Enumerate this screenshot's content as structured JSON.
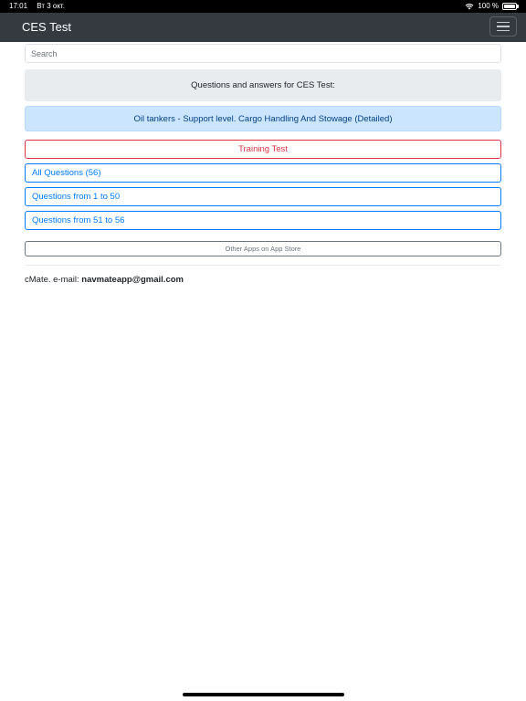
{
  "status_bar": {
    "time": "17:01",
    "date": "Вт 3 окт.",
    "battery": "100 %"
  },
  "navbar": {
    "title": "CES Test",
    "menu_icon": "hamburger-menu-icon"
  },
  "search": {
    "placeholder": "Search",
    "value": ""
  },
  "jumbotron": {
    "text": "Questions and answers for CES Test:"
  },
  "topic": {
    "text": "Oil tankers - Support level. Cargo Handling And Stowage (Detailed)"
  },
  "buttons": {
    "training_test": "Training Test",
    "all_questions": "All Questions (56)",
    "range_1": "Questions from 1 to 50",
    "range_2": "Questions from 51 to 56",
    "other_apps": "Other Apps on App Store"
  },
  "footer": {
    "prefix": "cMate. e-mail: ",
    "email": "navmateapp@gmail.com"
  },
  "colors": {
    "navbar_bg": "#343a40",
    "primary": "#007bff",
    "danger": "#dc3545",
    "secondary": "#6c757d",
    "info_bg": "#cce5ff"
  }
}
